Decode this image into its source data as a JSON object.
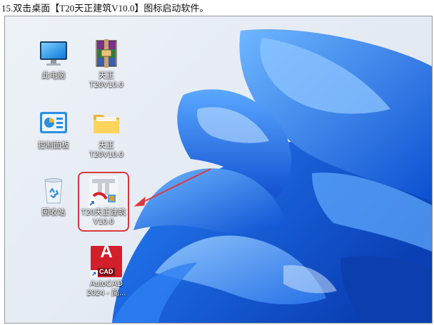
{
  "caption": "15.双击桌面【T20天正建筑V10.0】图标启动软件。",
  "desktop": {
    "icons": [
      {
        "label": "此电脑",
        "icon": "monitor-icon"
      },
      {
        "label": "天正\nT20V10.0",
        "icon": "winrar-archive-icon"
      },
      {
        "label": "控制面板",
        "icon": "control-panel-icon"
      },
      {
        "label": "天正\nT20V10.0",
        "icon": "folder-icon"
      },
      {
        "label": "回收站",
        "icon": "recycle-bin-icon"
      },
      {
        "label": "T20天正建筑\nV10.0",
        "icon": "tangent-t20-icon"
      },
      {
        "label": "AutoCAD\n2024 - 简...",
        "icon": "autocad-icon"
      }
    ],
    "autocad_badge": "CAD",
    "autocad_letter": "A"
  },
  "colors": {
    "highlight": "#d9363e",
    "arrow": "#e0393e",
    "wallpaper_blue": "#1f6fe0"
  }
}
